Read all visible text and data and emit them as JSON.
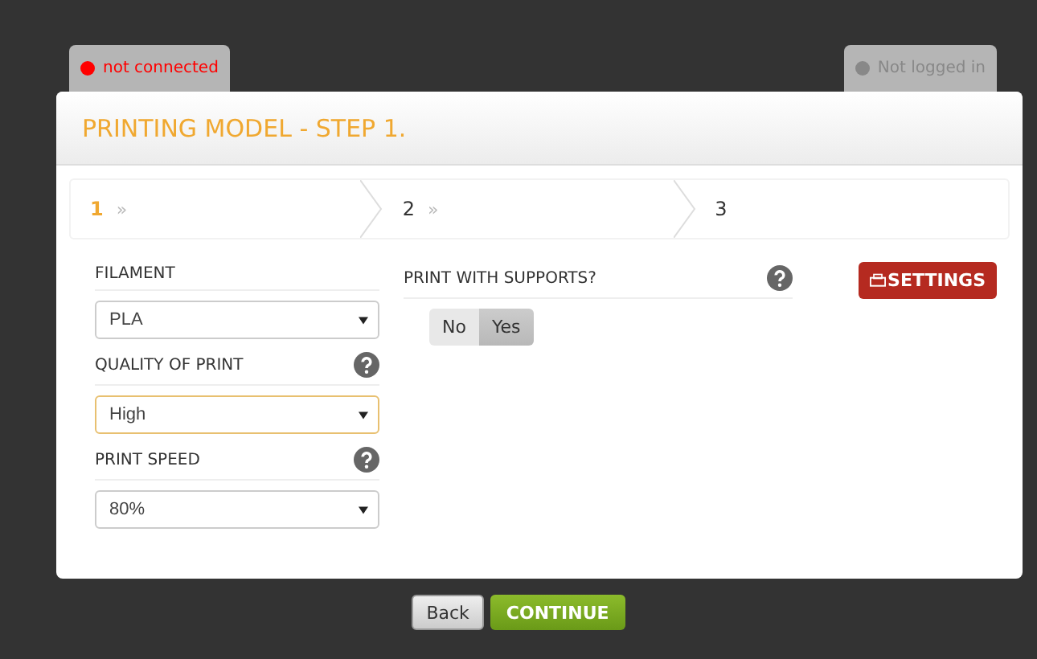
{
  "status_tabs": [
    {
      "label": "not connected",
      "color": "#ff0000"
    },
    {
      "label": "Not logged in",
      "color": "#888888"
    }
  ],
  "title": "PRINTING MODEL - STEP 1.",
  "steps": [
    {
      "label": "1",
      "marker": "»",
      "selected": true
    },
    {
      "label": "2",
      "marker": "»",
      "selected": false
    },
    {
      "label": "3",
      "selected": false
    }
  ],
  "fields": [
    {
      "label": "FILAMENT",
      "help": false,
      "value": "PLA",
      "focused": false
    },
    {
      "label": "QUALITY OF PRINT",
      "help": true,
      "value": "High",
      "focused": true
    },
    {
      "label": "PRINT SPEED",
      "help": true,
      "value": "80%",
      "focused": false
    }
  ],
  "supports": {
    "label": "PRINT WITH SUPPORTS?",
    "help": true,
    "options": [
      {
        "label": "No",
        "selected": false
      },
      {
        "label": "Yes",
        "selected": true
      }
    ]
  },
  "settings_button": "SETTINGS",
  "buttons": [
    {
      "label": "Back",
      "kind": "secondary"
    },
    {
      "label": "CONTINUE",
      "kind": "primary"
    }
  ]
}
